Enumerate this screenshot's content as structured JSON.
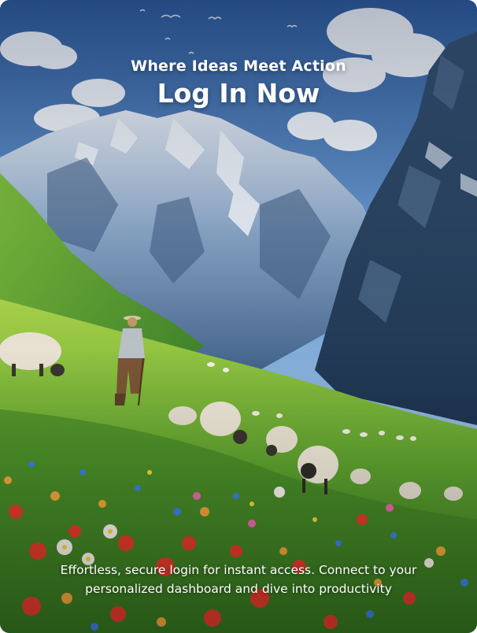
{
  "header": {
    "subtitle": "Where Ideas Meet Action",
    "title": "Log In Now"
  },
  "footer": {
    "description": "Effortless, secure login for instant access. Connect to your personalized dashboard and dive into productivity"
  },
  "background": {
    "icon": "mountain-meadow-illustration"
  }
}
